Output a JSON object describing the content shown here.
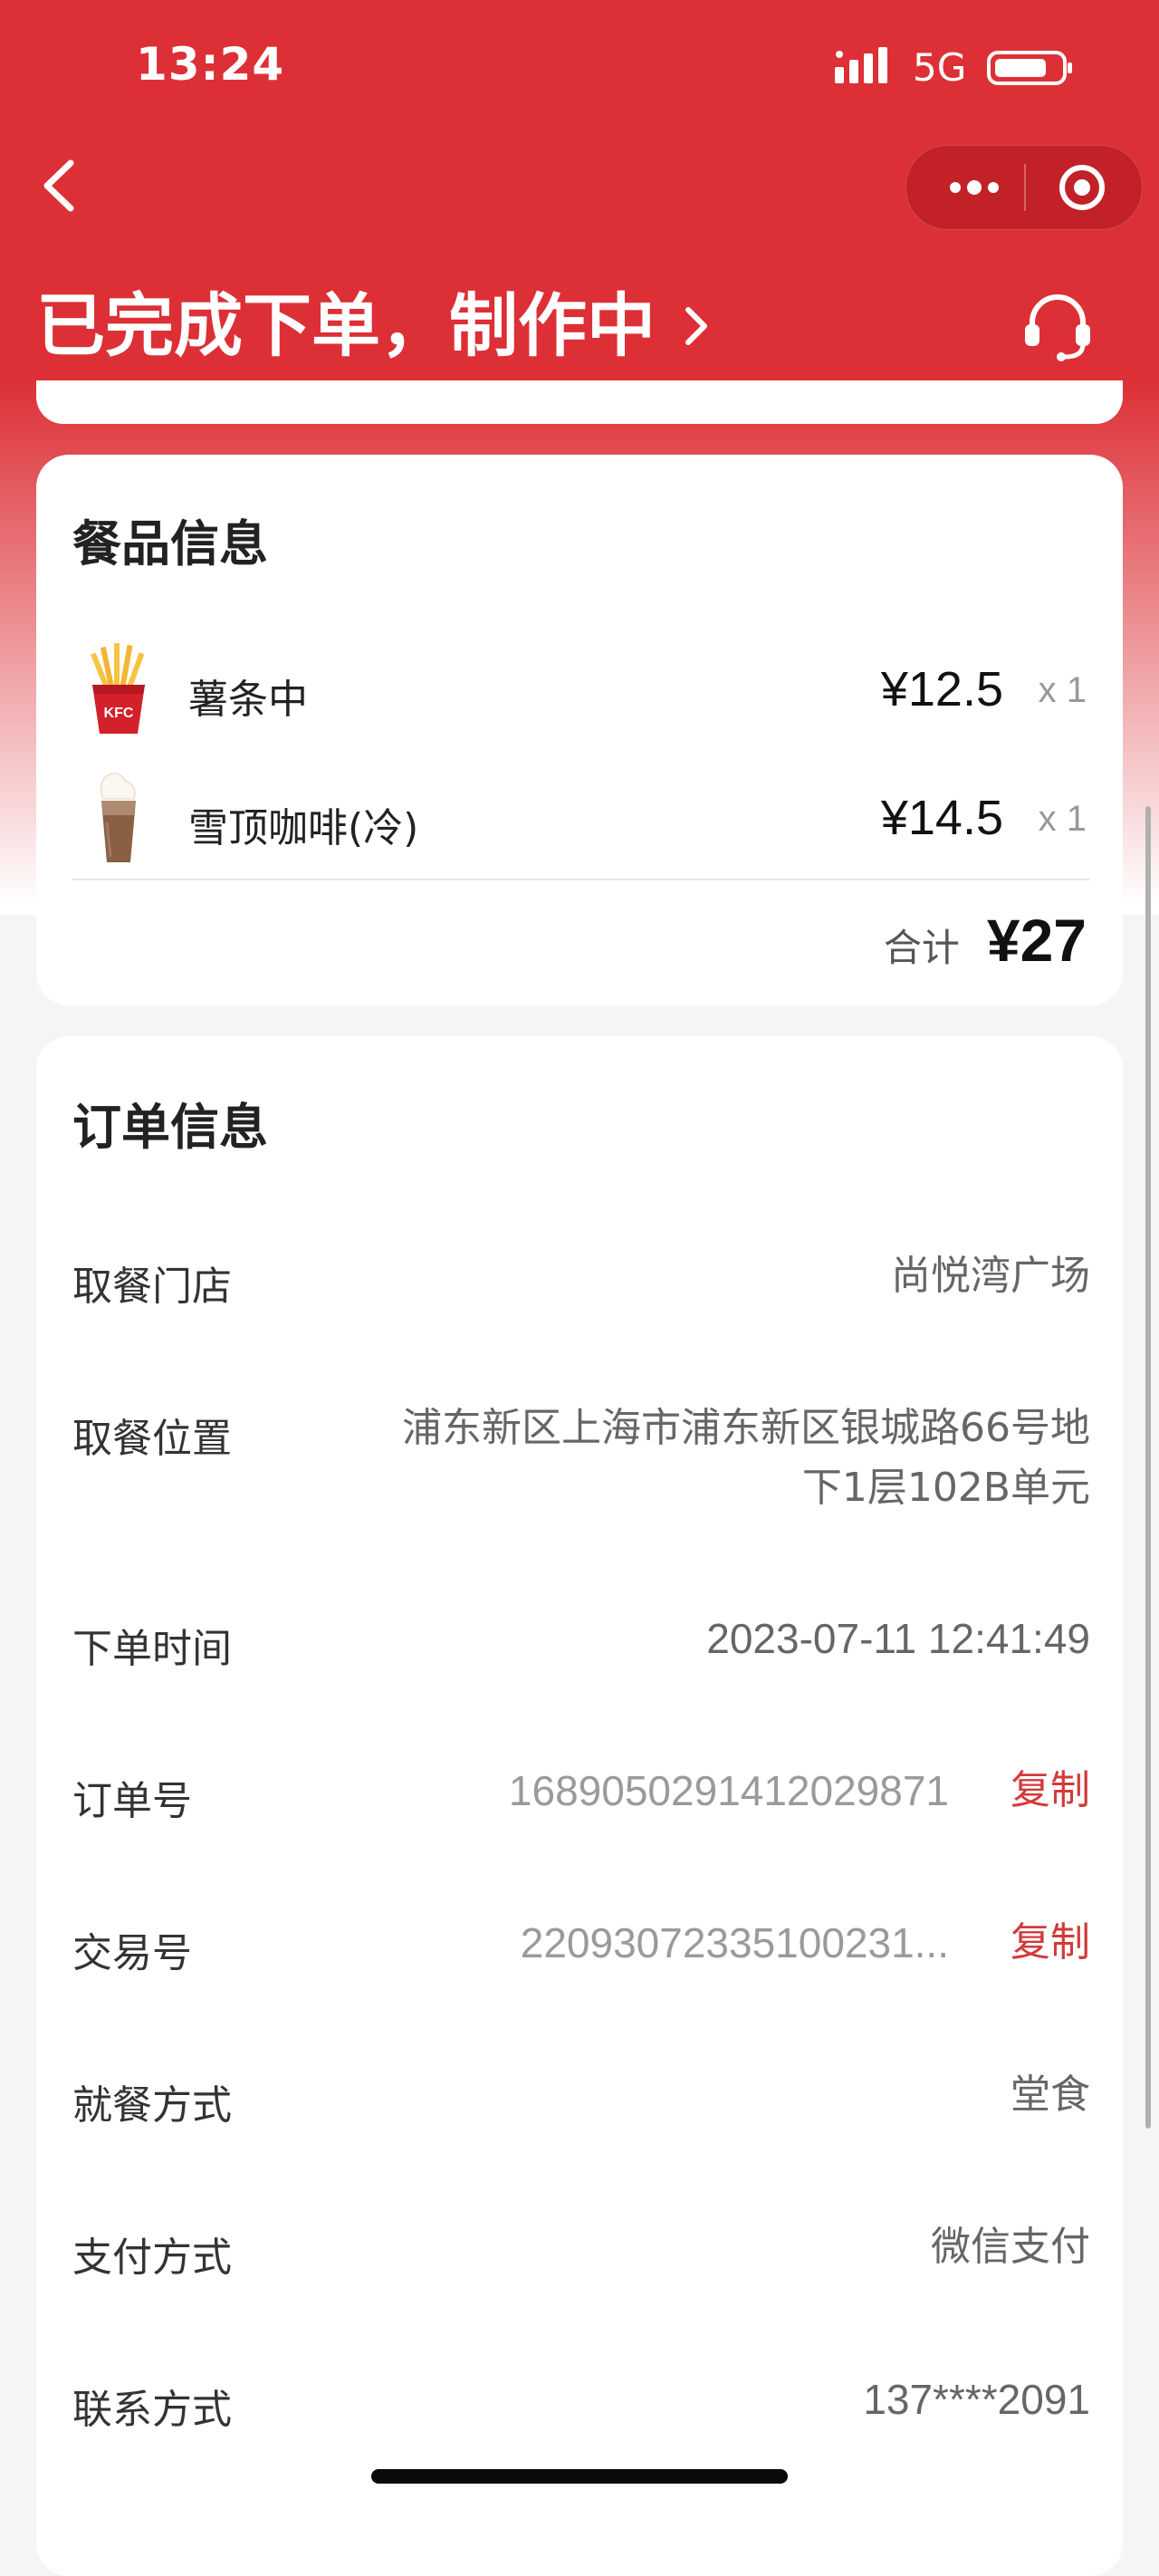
{
  "status_bar": {
    "time": "13:24",
    "network": "5G"
  },
  "nav": {
    "back_icon": "chevron-left-icon",
    "more_icon": "more-dots-icon",
    "close_icon": "target-circle-icon"
  },
  "header": {
    "status_text": "已完成下单，制作中",
    "service_icon": "headset-icon"
  },
  "food_card": {
    "title": "餐品信息",
    "items": [
      {
        "name": "薯条中",
        "price": "¥12.5",
        "qty": "x 1",
        "icon": "fries-icon"
      },
      {
        "name": "雪顶咖啡(冷)",
        "price": "¥14.5",
        "qty": "x 1",
        "icon": "iced-coffee-icon"
      }
    ],
    "total_label": "合计",
    "total_value": "¥27"
  },
  "order_card": {
    "title": "订单信息",
    "rows": [
      {
        "label": "取餐门店",
        "value": "尚悦湾广场"
      },
      {
        "label": "取餐位置",
        "value": "浦东新区上海市浦东新区银城路66号地下1层102B单元"
      },
      {
        "label": "下单时间",
        "value": "2023-07-11 12:41:49"
      },
      {
        "label": "订单号",
        "value": "1689050291412029871",
        "action": "复制"
      },
      {
        "label": "交易号",
        "value": "22093072335100231...",
        "action": "复制"
      },
      {
        "label": "就餐方式",
        "value": "堂食"
      },
      {
        "label": "支付方式",
        "value": "微信支付"
      },
      {
        "label": "联系方式",
        "value": "137****2091"
      }
    ]
  },
  "colors": {
    "brand_red": "#dc3036",
    "copy_red": "#d23a3a"
  }
}
